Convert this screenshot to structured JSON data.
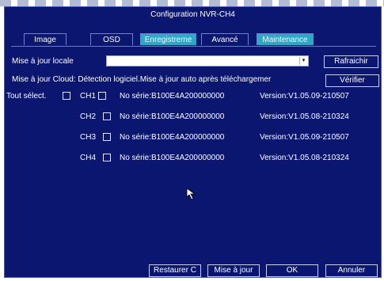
{
  "window": {
    "title": "Configuration NVR-CH4"
  },
  "tabs": [
    {
      "label": "Image",
      "active": false
    },
    {
      "label": "OSD",
      "active": false
    },
    {
      "label": "Enregistreme",
      "active": true
    },
    {
      "label": "Avancé",
      "active": false
    },
    {
      "label": "Maintenance",
      "active": true
    }
  ],
  "local_update": {
    "label": "Mise à jour locale",
    "selected": "",
    "refresh_label": "Rafraichir"
  },
  "cloud_update": {
    "text": "Mise à jour Cloud: Détection logiciel.Mise à jour auto après téléchargemer",
    "verify_label": "Vérifier"
  },
  "select_all": {
    "label": "Tout sélect.",
    "checked": false
  },
  "channels": [
    {
      "name": "CH1",
      "serial": "No série:B100E4A200000000",
      "version": "Version:V1.05.09-210507",
      "checked": false
    },
    {
      "name": "CH2",
      "serial": "No série:B100E4A200000000",
      "version": "Version:V1.05.08-210324",
      "checked": false
    },
    {
      "name": "CH3",
      "serial": "No série:B100E4A200000000",
      "version": "Version:V1.05.09-210507",
      "checked": false
    },
    {
      "name": "CH4",
      "serial": "No série:B100E4A200000000",
      "version": "Version:V1.05.08-210324",
      "checked": false
    }
  ],
  "footer": {
    "restore_label": "Restaurer C",
    "update_label": "Mise à jour",
    "ok_label": "OK",
    "cancel_label": "Annuler"
  },
  "colors": {
    "background": "#0a1670",
    "active_tab": "#2da9c8",
    "text": "#ffffff"
  },
  "icons": {
    "dropdown": "chevron-down-icon",
    "pointer": "mouse-cursor-icon"
  }
}
